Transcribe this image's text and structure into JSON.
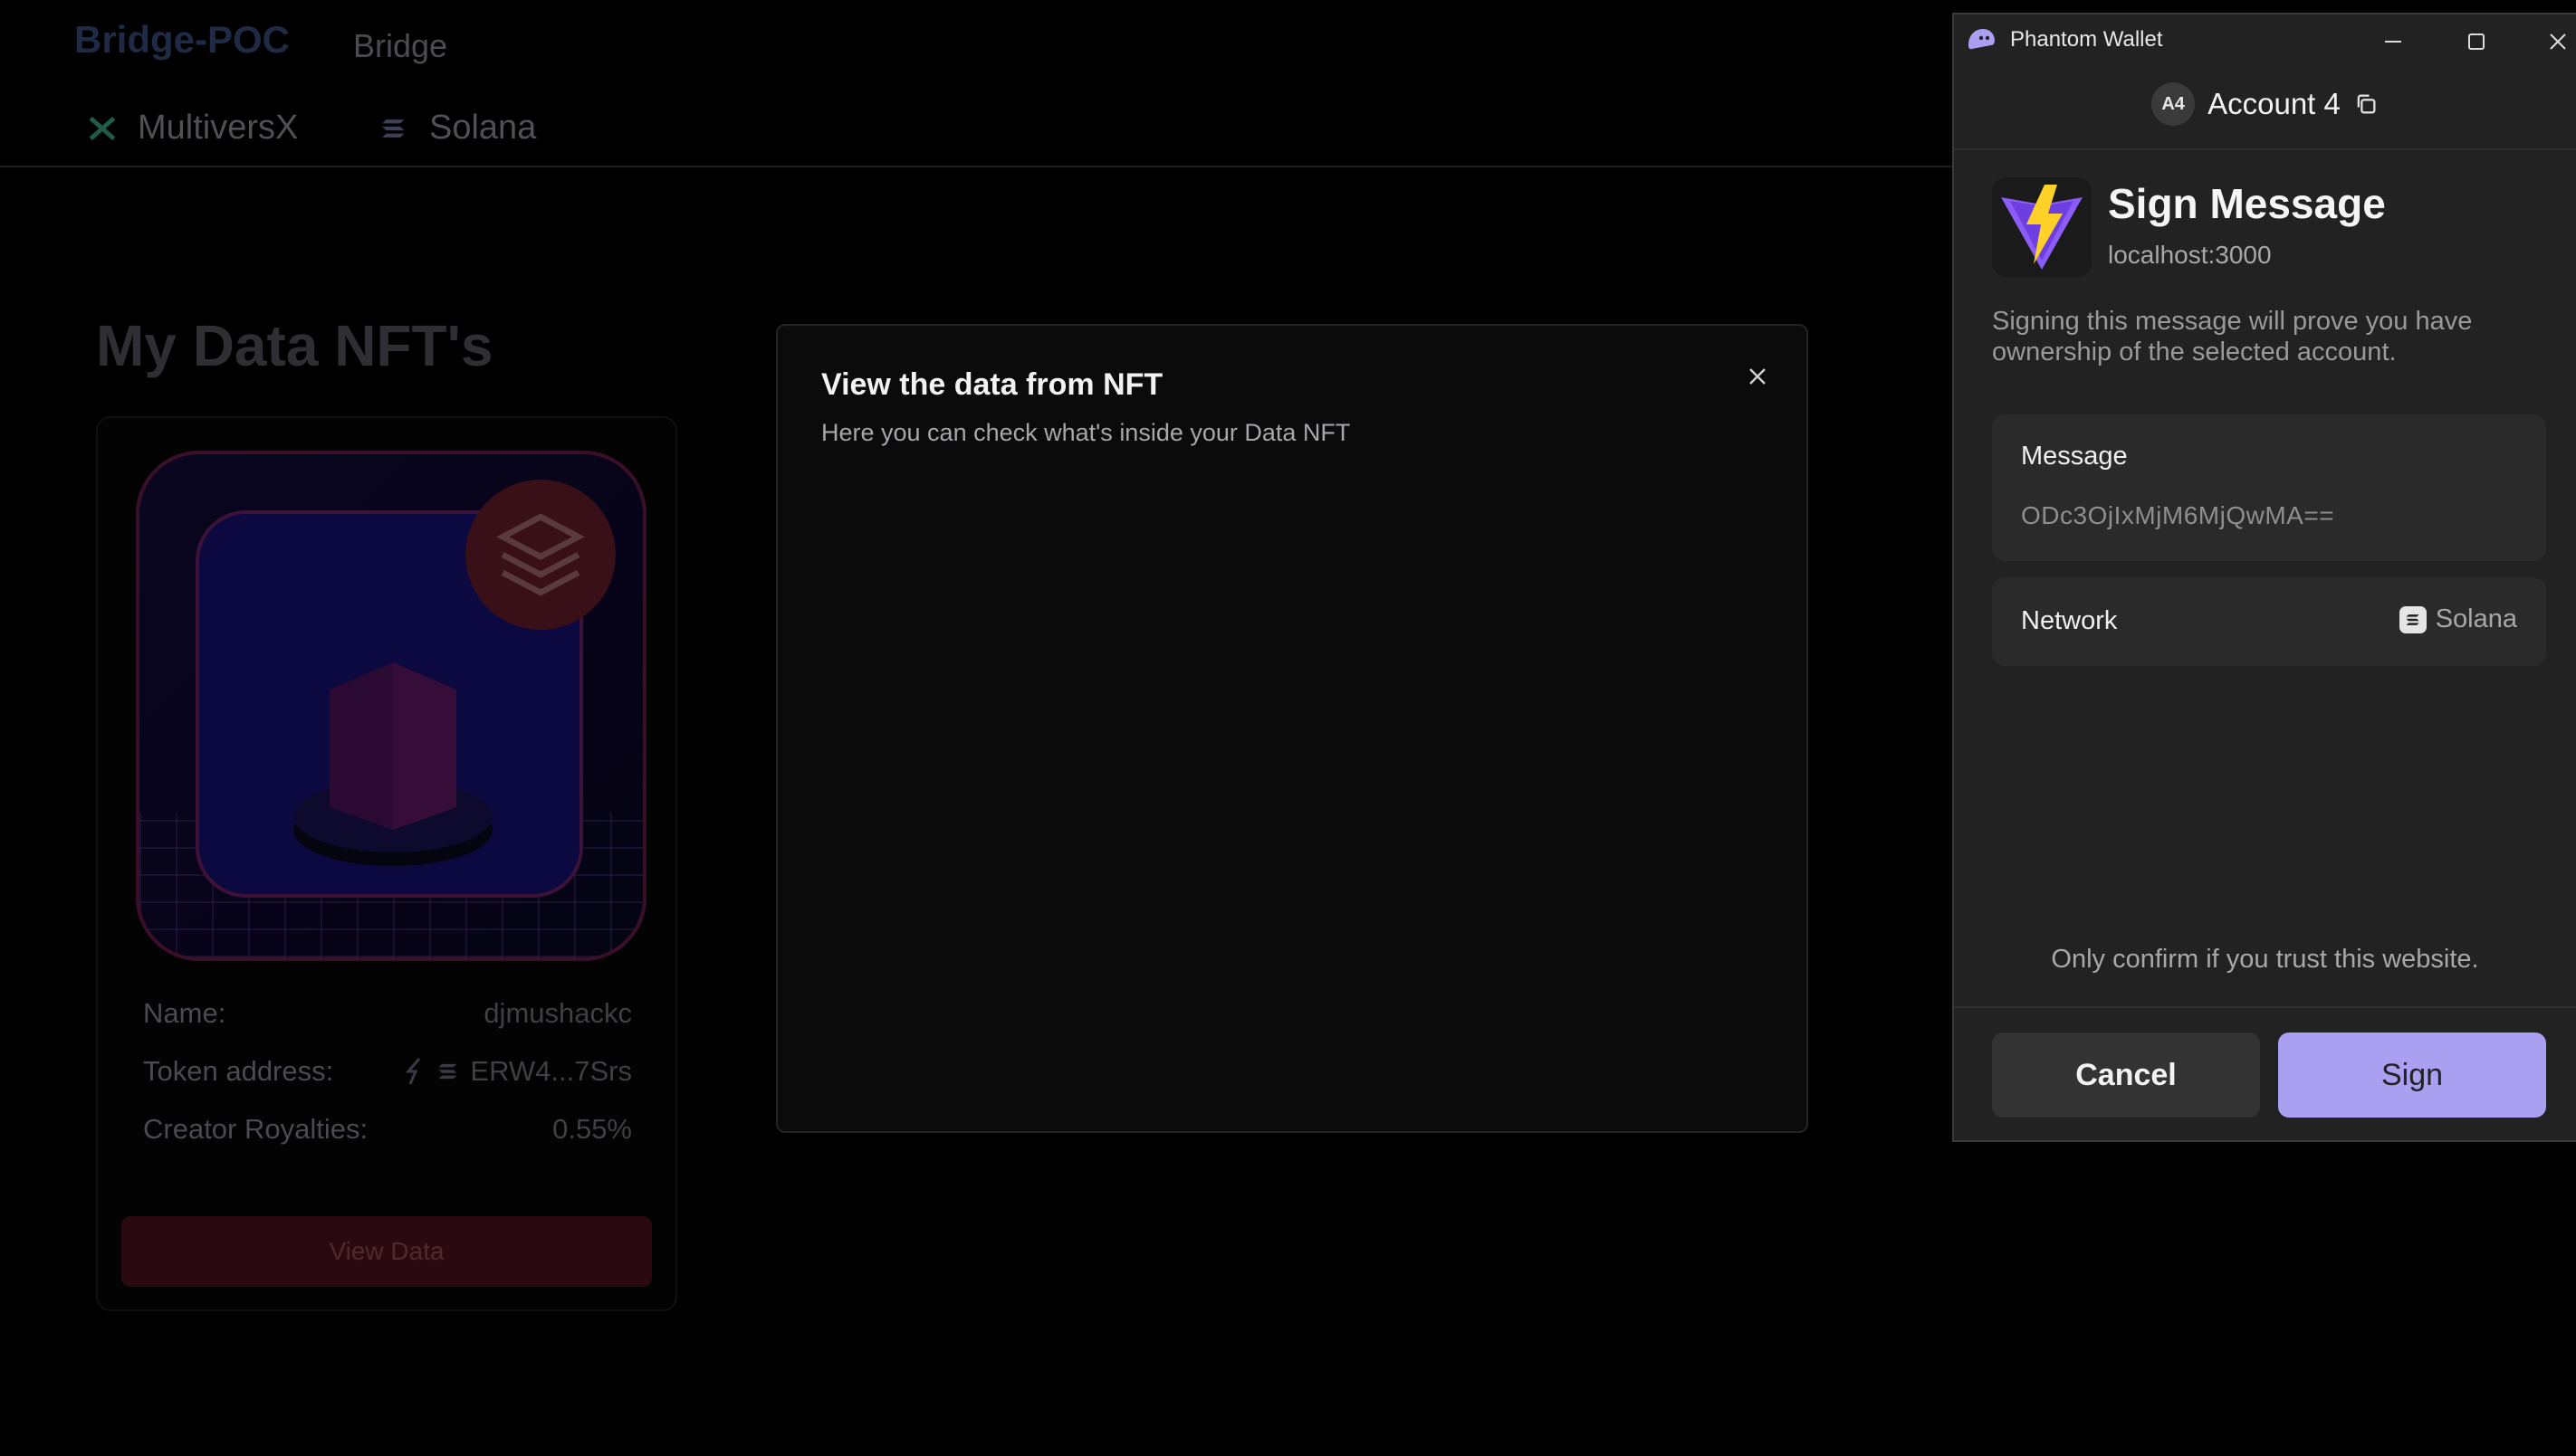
{
  "app": {
    "brand": "Bridge-POC",
    "nav_link": "Bridge",
    "chains": [
      {
        "label": "MultiversX",
        "icon": "multiversx-icon"
      },
      {
        "label": "Solana",
        "icon": "solana-icon"
      }
    ],
    "page_title": "My Data NFT's",
    "card": {
      "rows": [
        {
          "label": "Name:",
          "value": "djmushackc"
        },
        {
          "label": "Token address:",
          "value": "ERW4...7Srs"
        },
        {
          "label": "Creator Royalties:",
          "value": "0.55%"
        }
      ],
      "button": "View Data"
    }
  },
  "modal": {
    "title": "View the data from NFT",
    "subtitle": "Here you can check what's inside your Data NFT"
  },
  "wallet": {
    "window_title": "Phantom Wallet",
    "account_avatar": "A4",
    "account_name": "Account 4",
    "heading": "Sign Message",
    "origin": "localhost:3000",
    "description": "Signing this message will prove you have ownership of the selected account.",
    "message_label": "Message",
    "message_value": "ODc3OjIxMjM6MjQwMA==",
    "network_label": "Network",
    "network_value": "Solana",
    "trust_note": "Only confirm if you trust this website.",
    "cancel_label": "Cancel",
    "sign_label": "Sign",
    "accent_color": "#ab9ff2"
  }
}
